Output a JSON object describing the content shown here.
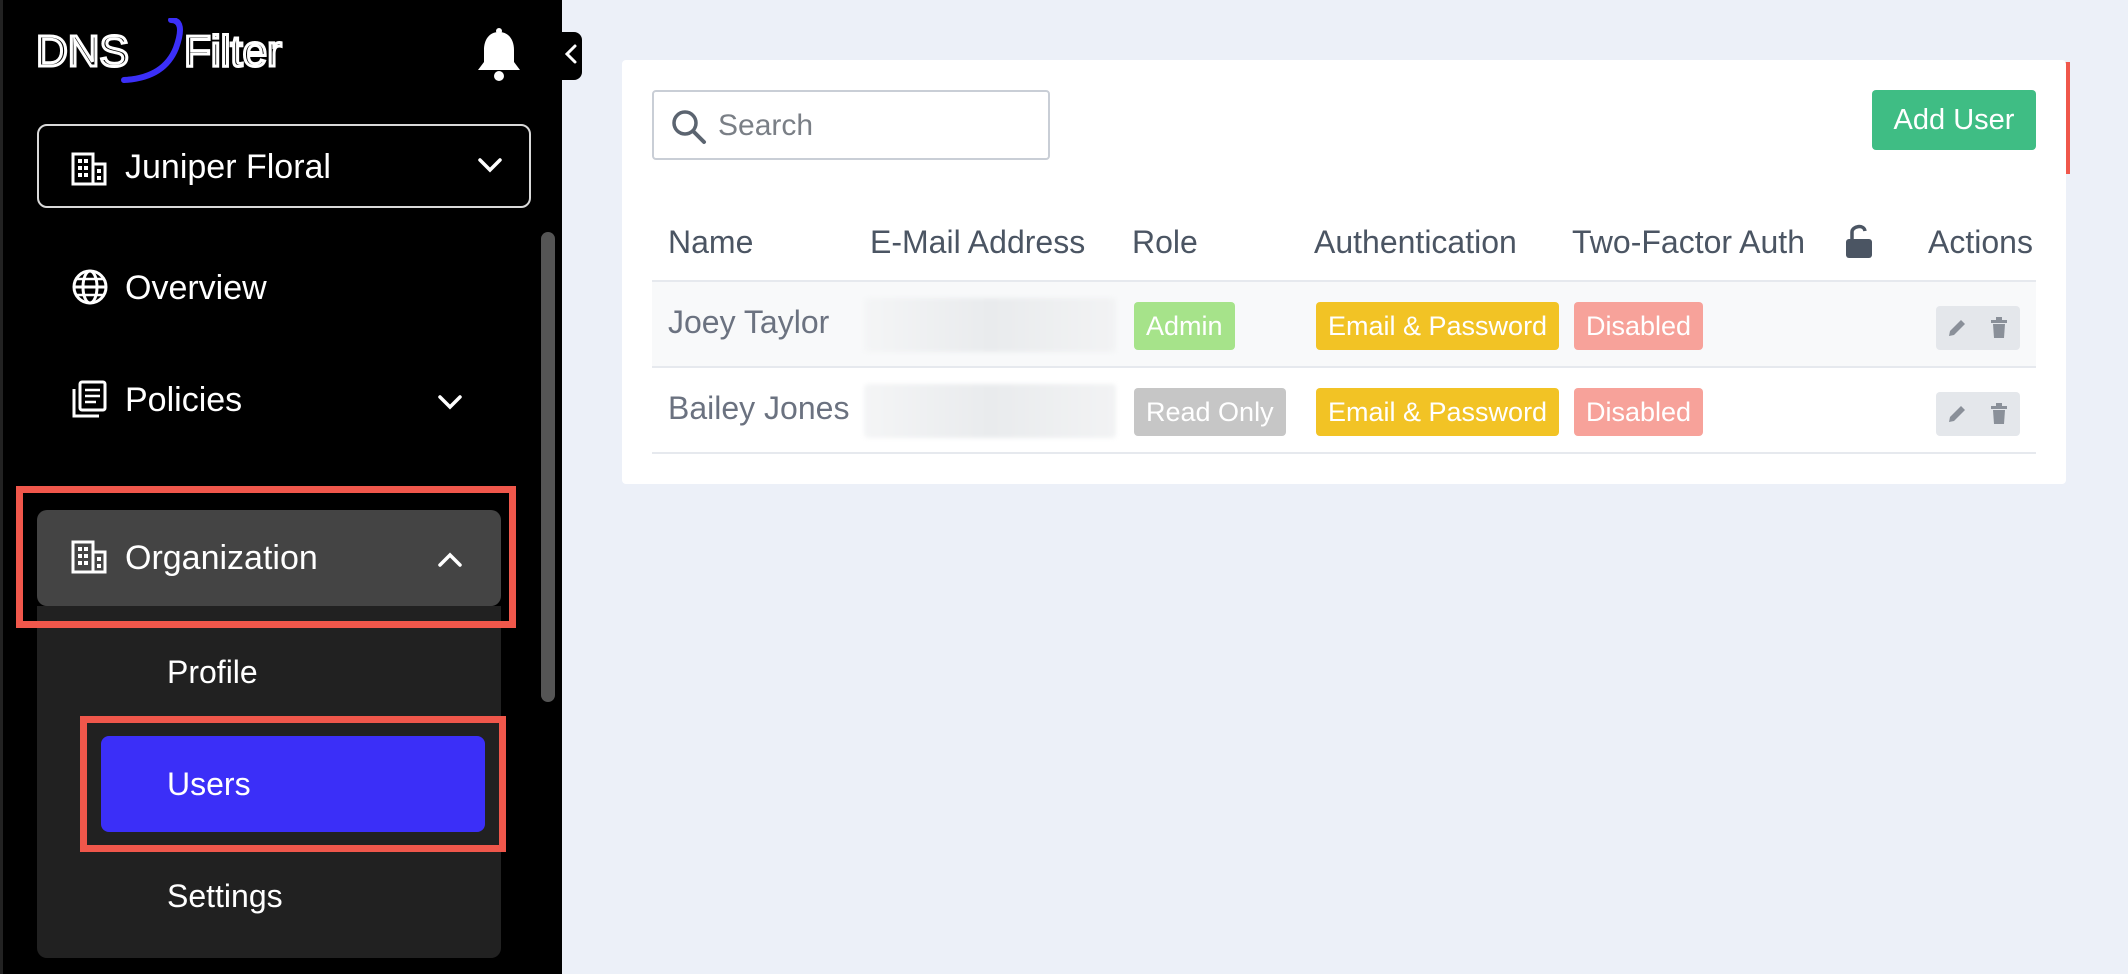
{
  "app": {
    "logo_text_left": "DNS",
    "logo_text_right": "Filter"
  },
  "sidebar": {
    "org_selector": {
      "label": "Juniper Floral"
    },
    "items": [
      {
        "label": "Overview",
        "icon": "globe-icon"
      },
      {
        "label": "Policies",
        "icon": "policies-icon"
      },
      {
        "label": "Organization",
        "icon": "building-icon",
        "expanded": true
      }
    ],
    "submenu": [
      {
        "label": "Profile"
      },
      {
        "label": "Users",
        "active": true
      },
      {
        "label": "Settings"
      }
    ]
  },
  "toolbar": {
    "search_placeholder": "Search",
    "add_user_label": "Add User"
  },
  "table": {
    "headers": [
      "Name",
      "E-Mail Address",
      "Role",
      "Authentication",
      "Two-Factor Auth",
      "Actions"
    ],
    "rows": [
      {
        "name": "Joey Taylor",
        "email": "",
        "role": "Admin",
        "authentication": "Email & Password",
        "two_factor": "Disabled"
      },
      {
        "name": "Bailey Jones",
        "email": "",
        "role": "Read Only",
        "authentication": "Email & Password",
        "two_factor": "Disabled"
      }
    ]
  },
  "colors": {
    "accent": "#3b2ff8",
    "add_button": "#3fbd84",
    "highlight": "#f0574b",
    "badge_admin": "#a6e38a",
    "badge_read_only": "#c6c6c6",
    "badge_auth": "#f2c325",
    "badge_disabled": "#f7a29a"
  }
}
